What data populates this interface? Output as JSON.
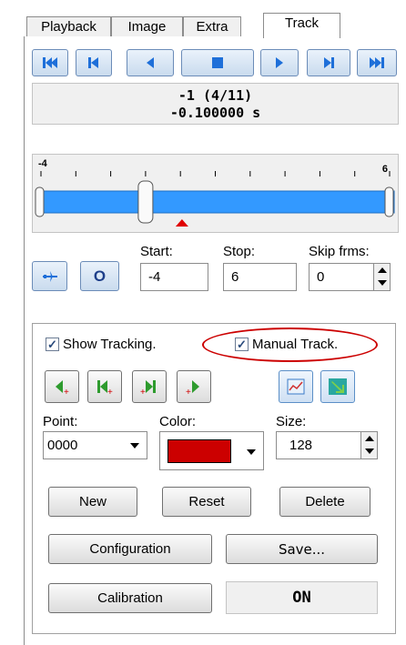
{
  "tabs": [
    {
      "label": "Playback"
    },
    {
      "label": "Image"
    },
    {
      "label": "Extra"
    },
    {
      "label": "Track",
      "active": true
    }
  ],
  "transport": [
    "first-frame-icon",
    "prev-keyframe-icon",
    "step-back-icon",
    "stop-icon",
    "play-icon",
    "next-keyframe-icon",
    "last-frame-icon"
  ],
  "readout": {
    "frame": "-1 (4/11)",
    "time": "-0.100000 s"
  },
  "slider": {
    "min_label": "-4",
    "max_label": "6",
    "min": -4,
    "max": 6,
    "value": -1,
    "marker": -1,
    "fill_color": "#3399ff",
    "marker_color": "#e00000"
  },
  "range": {
    "start_label": "Start:",
    "start_value": "-4",
    "stop_label": "Stop:",
    "stop_value": "6",
    "skip_label": "Skip frms:",
    "skip_value": "0"
  },
  "tracking": {
    "show_tracking_label": "Show Tracking.",
    "show_tracking_checked": true,
    "manual_track_label": "Manual Track.",
    "manual_track_checked": true,
    "highlight_color": "#cc0000"
  },
  "point": {
    "label": "Point:",
    "value": "0000"
  },
  "color": {
    "label": "Color:",
    "value": "#cc0000"
  },
  "size": {
    "label": "Size:",
    "value": "128"
  },
  "buttons": {
    "new": "New",
    "reset": "Reset",
    "delete": "Delete",
    "configuration": "Configuration",
    "save": "Save...",
    "calibration": "Calibration"
  },
  "status": {
    "value": "ON"
  }
}
